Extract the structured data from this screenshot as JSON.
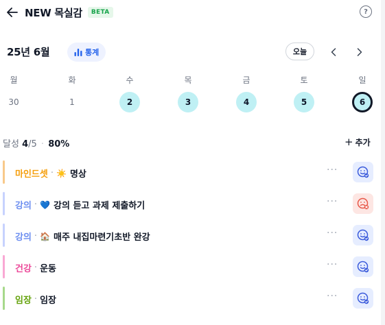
{
  "header": {
    "title": "NEW 목실감",
    "badge": "BETA",
    "help_label": "?"
  },
  "calendar": {
    "month": "25년 6월",
    "stats_label": "통계",
    "today_label": "오늘",
    "weekdays": [
      "월",
      "화",
      "수",
      "목",
      "금",
      "토",
      "일"
    ],
    "days": [
      {
        "num": "30",
        "done": false,
        "selected": false
      },
      {
        "num": "1",
        "done": false,
        "selected": false
      },
      {
        "num": "2",
        "done": true,
        "selected": false
      },
      {
        "num": "3",
        "done": true,
        "selected": false
      },
      {
        "num": "4",
        "done": true,
        "selected": false
      },
      {
        "num": "5",
        "done": true,
        "selected": false
      },
      {
        "num": "6",
        "done": true,
        "selected": true
      }
    ]
  },
  "summary": {
    "label": "달성",
    "count": "4",
    "total": "/5",
    "percent": "80%",
    "add_label": "추가"
  },
  "tasks": [
    {
      "category": "마인드셋",
      "emoji": "☀️",
      "title": "명상",
      "bar_color": "#f8c98a",
      "cat_color": "#f59e0b",
      "status": "done"
    },
    {
      "category": "강의",
      "emoji": "💙",
      "title": "강의 듣고 과제 제출하기",
      "bar_color": "#c7d2fe",
      "cat_color": "#6b8df0",
      "status": "missed"
    },
    {
      "category": "강의",
      "emoji": "🏠",
      "title": "매주 내집마련기초반 완강",
      "bar_color": "#c7d2fe",
      "cat_color": "#6b8df0",
      "status": "done"
    },
    {
      "category": "건강",
      "emoji": "",
      "title": "운동",
      "bar_color": "#f9a8d4",
      "cat_color": "#ec4899",
      "status": "done"
    },
    {
      "category": "임장",
      "emoji": "",
      "title": "임장",
      "bar_color": "#a7d98b",
      "cat_color": "#65a30d",
      "status": "done"
    }
  ],
  "more_label": "···"
}
